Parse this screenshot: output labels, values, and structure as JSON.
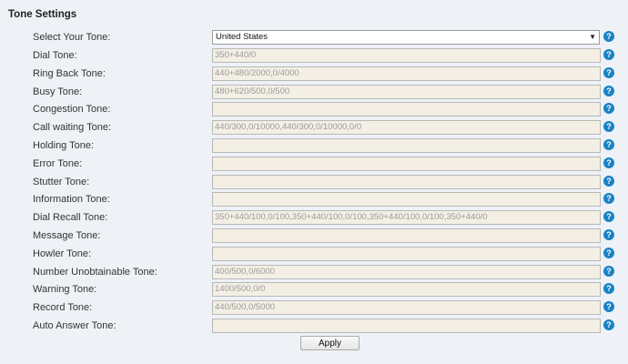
{
  "section_title": "Tone Settings",
  "select_tone": {
    "label": "Select Your Tone:",
    "value": "United States",
    "arrow": "▼"
  },
  "tones": [
    {
      "label": "Dial Tone:",
      "value": "350+440/0"
    },
    {
      "label": "Ring Back Tone:",
      "value": "440+480/2000,0/4000"
    },
    {
      "label": "Busy Tone:",
      "value": "480+620/500,0/500"
    },
    {
      "label": "Congestion Tone:",
      "value": ""
    },
    {
      "label": "Call waiting Tone:",
      "value": "440/300,0/10000,440/300,0/10000,0/0"
    },
    {
      "label": "Holding Tone:",
      "value": ""
    },
    {
      "label": "Error Tone:",
      "value": ""
    },
    {
      "label": "Stutter Tone:",
      "value": ""
    },
    {
      "label": "Information Tone:",
      "value": ""
    },
    {
      "label": "Dial Recall Tone:",
      "value": "350+440/100,0/100,350+440/100,0/100,350+440/100,0/100,350+440/0"
    },
    {
      "label": "Message Tone:",
      "value": ""
    },
    {
      "label": "Howler Tone:",
      "value": ""
    },
    {
      "label": "Number Unobtainable Tone:",
      "value": "400/500,0/6000"
    },
    {
      "label": "Warning Tone:",
      "value": "1400/500,0/0"
    },
    {
      "label": "Record Tone:",
      "value": "440/500,0/5000"
    },
    {
      "label": "Auto Answer Tone:",
      "value": ""
    }
  ],
  "help_glyph": "?",
  "apply_label": "Apply",
  "colors": {
    "help_icon": "#1a83c6",
    "field_background": "#f3efe4",
    "page_background": "#eef2f7"
  }
}
